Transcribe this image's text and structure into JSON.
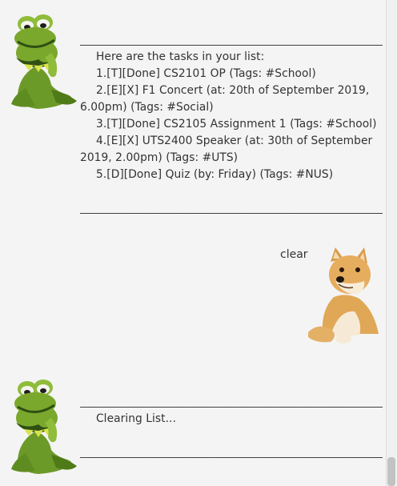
{
  "divider": "______________________________________________________________",
  "bot_message_1": {
    "header": "Here are the tasks in your list:",
    "tasks": [
      "1.[T][Done] CS2101 OP  (Tags: #School)",
      "2.[E][X] F1 Concert (at: 20th of September 2019,",
      "6.00pm) (Tags: #Social)",
      "3.[T][Done] CS2105 Assignment 1  (Tags: #School)",
      "4.[E][X] UTS2400 Speaker (at: 30th of September",
      "2019, 2.00pm) (Tags: #UTS)",
      "5.[D][Done] Quiz (by: Friday) (Tags: #NUS)"
    ]
  },
  "user_message": {
    "text": "clear"
  },
  "bot_message_2": {
    "text": "Clearing List..."
  },
  "icons": {
    "bot_avatar": "kermit-frog-avatar",
    "user_avatar": "doge-shiba-avatar"
  },
  "colors": {
    "background": "#f4f4f4",
    "text": "#333333"
  }
}
